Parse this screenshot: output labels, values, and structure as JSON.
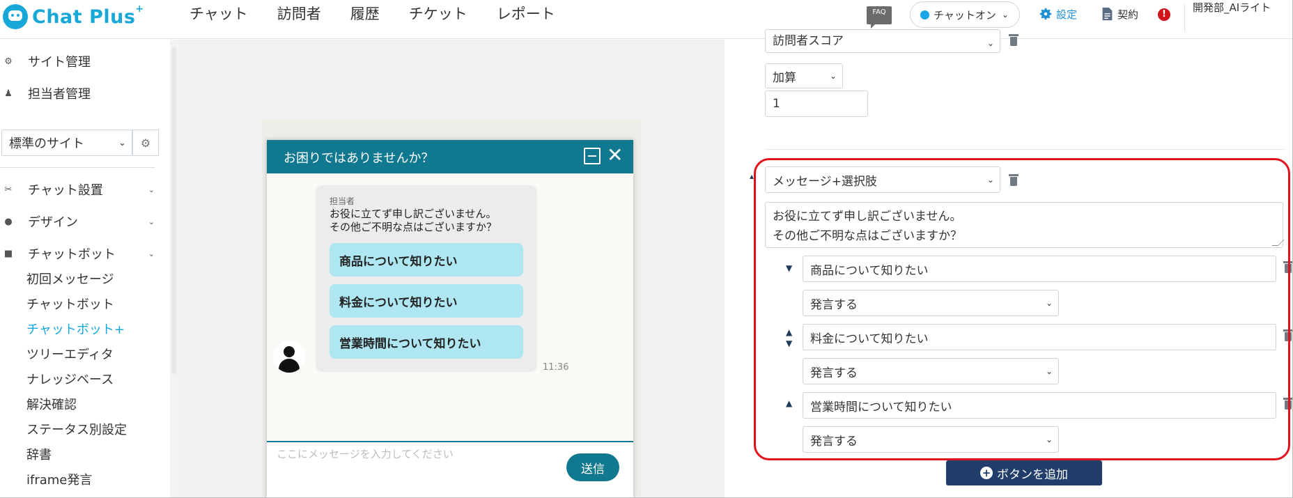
{
  "header": {
    "logo_text": "Chat Plus",
    "logo_sup": "+",
    "nav": [
      "チャット",
      "訪問者",
      "履歴",
      "チケット",
      "レポート"
    ],
    "faq": "FAQ",
    "chat_status": "チャットオン",
    "settings": "設定",
    "contract": "契約",
    "user": "開発部_AIライト"
  },
  "sidebar": {
    "site_admin": "サイト管理",
    "staff_admin": "担当者管理",
    "site_select": "標準のサイト",
    "menu": [
      "チャット設置",
      "デザイン",
      "チャットボット"
    ],
    "submenu": [
      "初回メッセージ",
      "チャットボット",
      "チャットボット+",
      "ツリーエディタ",
      "ナレッジベース",
      "解決確認",
      "ステータス別設定",
      "辞書",
      "iframe発言"
    ],
    "active_submenu": "チャットボット+"
  },
  "widget": {
    "title": "お困りではありませんか？",
    "sender": "担当者",
    "message": "お役に立てず申し訳ございません。\nその他ご不明な点はございますか？",
    "options": [
      "商品について知りたい",
      "料金について知りたい",
      "営業時間について知りたい"
    ],
    "time": "11:36",
    "input_placeholder": "ここにメッセージを入力してください",
    "send": "送信"
  },
  "editor": {
    "top_select": "訪問者スコア",
    "op_select": "加算",
    "score_value": "1",
    "type_select": "メッセージ+選択肢",
    "message": "お役に立てず申し訳ございません。\nその他ご不明な点はございますか？",
    "choices": [
      {
        "label": "商品について知りたい",
        "action": "発言する"
      },
      {
        "label": "料金について知りたい",
        "action": "発言する"
      },
      {
        "label": "営業時間について知りたい",
        "action": "発言する"
      }
    ],
    "add_button": "ボタンを追加"
  },
  "colors": {
    "brand": "#17a8d8",
    "widget_header": "#10788f",
    "option_bg": "#aee6f1",
    "highlight": "#e0131c",
    "add_button": "#213e6b"
  }
}
